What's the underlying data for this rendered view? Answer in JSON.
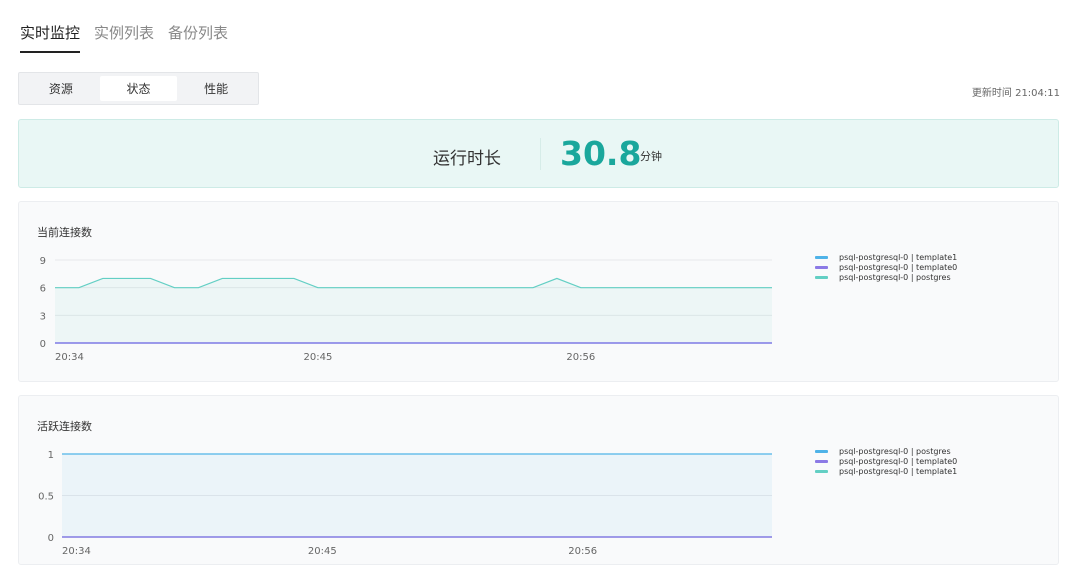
{
  "tabs": [
    {
      "label": "实时监控",
      "active": true
    },
    {
      "label": "实例列表",
      "active": false
    },
    {
      "label": "备份列表",
      "active": false
    }
  ],
  "segments": [
    {
      "label": "资源",
      "active": false
    },
    {
      "label": "状态",
      "active": true
    },
    {
      "label": "性能",
      "active": false
    }
  ],
  "update_time": "更新时间 21:04:11",
  "uptime": {
    "label": "运行时长",
    "value": "30.8",
    "unit": "分钟",
    "color": "#1aa79c"
  },
  "chart_data": [
    {
      "type": "line",
      "title": "当前连接数",
      "x_ticks": [
        "20:34",
        "20:45",
        "20:56"
      ],
      "y_ticks": [
        "0",
        "3",
        "6",
        "9"
      ],
      "ylim": [
        0,
        9
      ],
      "grid": true,
      "legend_position": "right",
      "x": [
        "20:34",
        "20:35",
        "20:36",
        "20:37",
        "20:38",
        "20:39",
        "20:40",
        "20:41",
        "20:42",
        "20:43",
        "20:44",
        "20:45",
        "20:46",
        "20:47",
        "20:48",
        "20:49",
        "20:50",
        "20:51",
        "20:52",
        "20:53",
        "20:54",
        "20:55",
        "20:56",
        "20:57",
        "20:58",
        "20:59",
        "21:00",
        "21:01",
        "21:02",
        "21:03",
        "21:04"
      ],
      "series": [
        {
          "name": "psql-postgresql-0 | template1",
          "color": "#4fb3e8",
          "values": [
            0,
            0,
            0,
            0,
            0,
            0,
            0,
            0,
            0,
            0,
            0,
            0,
            0,
            0,
            0,
            0,
            0,
            0,
            0,
            0,
            0,
            0,
            0,
            0,
            0,
            0,
            0,
            0,
            0,
            0,
            0
          ]
        },
        {
          "name": "psql-postgresql-0 | template0",
          "color": "#8c7ae6",
          "values": [
            0,
            0,
            0,
            0,
            0,
            0,
            0,
            0,
            0,
            0,
            0,
            0,
            0,
            0,
            0,
            0,
            0,
            0,
            0,
            0,
            0,
            0,
            0,
            0,
            0,
            0,
            0,
            0,
            0,
            0,
            0
          ]
        },
        {
          "name": "psql-postgresql-0 | postgres",
          "color": "#63cfc4",
          "values": [
            6,
            6,
            7,
            7,
            7,
            6,
            6,
            7,
            7,
            7,
            7,
            6,
            6,
            6,
            6,
            6,
            6,
            6,
            6,
            6,
            6,
            7,
            6,
            6,
            6,
            6,
            6,
            6,
            6,
            6,
            6
          ]
        }
      ]
    },
    {
      "type": "line",
      "title": "活跃连接数",
      "x_ticks": [
        "20:34",
        "20:45",
        "20:56"
      ],
      "y_ticks": [
        "0",
        "0.5",
        "1"
      ],
      "ylim": [
        0,
        1
      ],
      "grid": true,
      "legend_position": "right",
      "x": [
        "20:34",
        "20:35",
        "20:36",
        "20:37",
        "20:38",
        "20:39",
        "20:40",
        "20:41",
        "20:42",
        "20:43",
        "20:44",
        "20:45",
        "20:46",
        "20:47",
        "20:48",
        "20:49",
        "20:50",
        "20:51",
        "20:52",
        "20:53",
        "20:54",
        "20:55",
        "20:56",
        "20:57",
        "20:58",
        "20:59",
        "21:00",
        "21:01",
        "21:02",
        "21:03",
        "21:04"
      ],
      "series": [
        {
          "name": "psql-postgresql-0 | postgres",
          "color": "#4fb3e8",
          "values": [
            1,
            1,
            1,
            1,
            1,
            1,
            1,
            1,
            1,
            1,
            1,
            1,
            1,
            1,
            1,
            1,
            1,
            1,
            1,
            1,
            1,
            1,
            1,
            1,
            1,
            1,
            1,
            1,
            1,
            1,
            1
          ]
        },
        {
          "name": "psql-postgresql-0 | template0",
          "color": "#8c7ae6",
          "values": [
            0,
            0,
            0,
            0,
            0,
            0,
            0,
            0,
            0,
            0,
            0,
            0,
            0,
            0,
            0,
            0,
            0,
            0,
            0,
            0,
            0,
            0,
            0,
            0,
            0,
            0,
            0,
            0,
            0,
            0,
            0
          ]
        },
        {
          "name": "psql-postgresql-0 | template1",
          "color": "#63cfc4",
          "values": [
            0,
            0,
            0,
            0,
            0,
            0,
            0,
            0,
            0,
            0,
            0,
            0,
            0,
            0,
            0,
            0,
            0,
            0,
            0,
            0,
            0,
            0,
            0,
            0,
            0,
            0,
            0,
            0,
            0,
            0,
            0
          ]
        }
      ]
    }
  ]
}
